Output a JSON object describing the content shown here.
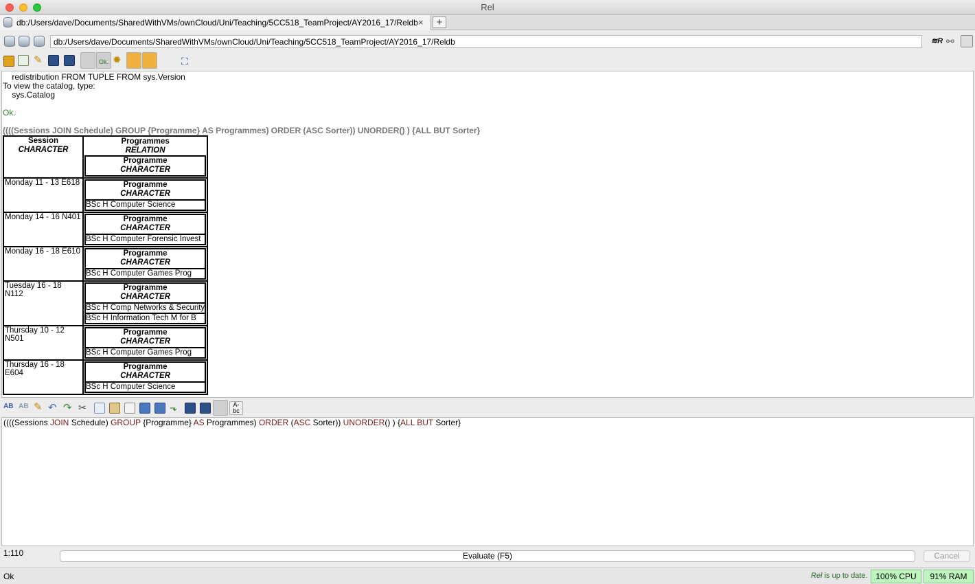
{
  "window": {
    "title": "Rel"
  },
  "tab": {
    "label": "db:/Users/dave/Documents/SharedWithVMs/ownCloud/Uni/Teaching/5CC518_TeamProject/AY2016_17/Reldb",
    "close": "×",
    "add": "+"
  },
  "path": {
    "value": "db:/Users/dave/Documents/SharedWithVMs/ownCloud/Uni/Teaching/5CC518_TeamProject/AY2016_17/Reldb"
  },
  "toolbar1": {
    "ok_label": "Ok."
  },
  "output": {
    "lines": [
      "    redistribution FROM TUPLE FROM sys.Version",
      "To view the catalog, type:",
      "    sys.Catalog"
    ],
    "ok": "Ok.",
    "query_echo": "((((Sessions JOIN Schedule) GROUP {Programme} AS Programmes) ORDER (ASC Sorter)) UNORDER() ) {ALL BUT Sorter}",
    "table": {
      "headers": [
        {
          "name": "Session",
          "type": "CHARACTER"
        },
        {
          "name": "Programmes",
          "type": "RELATION",
          "inner_name": "Programme",
          "inner_type": "CHARACTER"
        }
      ],
      "rows": [
        {
          "session": "Monday 11 - 13 E618",
          "inner_header": "Programme",
          "inner_type": "CHARACTER",
          "programmes": [
            "BSc H Computer Science"
          ]
        },
        {
          "session": "Monday 14 - 16 N401",
          "inner_header": "Programme",
          "inner_type": "CHARACTER",
          "programmes": [
            "BSc H Computer Forensic Invest"
          ]
        },
        {
          "session": "Monday 16 - 18 E610",
          "inner_header": "Programme",
          "inner_type": "CHARACTER",
          "programmes": [
            "BSc H Computer Games Prog"
          ]
        },
        {
          "session": "Tuesday 16 - 18 N112",
          "inner_header": "Programme",
          "inner_type": "CHARACTER",
          "programmes": [
            "BSc H Comp Networks & Security",
            "BSc H Information Tech M for B"
          ]
        },
        {
          "session": "Thursday 10 - 12 N501",
          "inner_header": "Programme",
          "inner_type": "CHARACTER",
          "programmes": [
            "BSc H Computer Games Prog"
          ]
        },
        {
          "session": "Thursday 16 - 18 E604",
          "inner_header": "Programme",
          "inner_type": "CHARACTER",
          "programmes": [
            "BSc H Computer Science"
          ]
        }
      ]
    }
  },
  "editor": {
    "tokens": [
      {
        "t": "((((Sessions ",
        "k": false
      },
      {
        "t": "JOIN",
        "k": true
      },
      {
        "t": " Schedule) ",
        "k": false
      },
      {
        "t": "GROUP",
        "k": true
      },
      {
        "t": " {Programme} ",
        "k": false
      },
      {
        "t": "AS",
        "k": true
      },
      {
        "t": " Programmes) ",
        "k": false
      },
      {
        "t": "ORDER",
        "k": true
      },
      {
        "t": " (",
        "k": false
      },
      {
        "t": "ASC",
        "k": true
      },
      {
        "t": " Sorter)) ",
        "k": false
      },
      {
        "t": "UNORDER",
        "k": true
      },
      {
        "t": "() ) {",
        "k": false
      },
      {
        "t": "ALL BUT",
        "k": true
      },
      {
        "t": " Sorter}",
        "k": false
      }
    ]
  },
  "bottom": {
    "position": "1:110",
    "evaluate_label": "Evaluate (F5)",
    "cancel_label": "Cancel"
  },
  "status": {
    "left": "Ok",
    "update_app": "Rel",
    "update_msg": " is up to date.",
    "cpu": "100% CPU",
    "ram": "91% RAM"
  }
}
